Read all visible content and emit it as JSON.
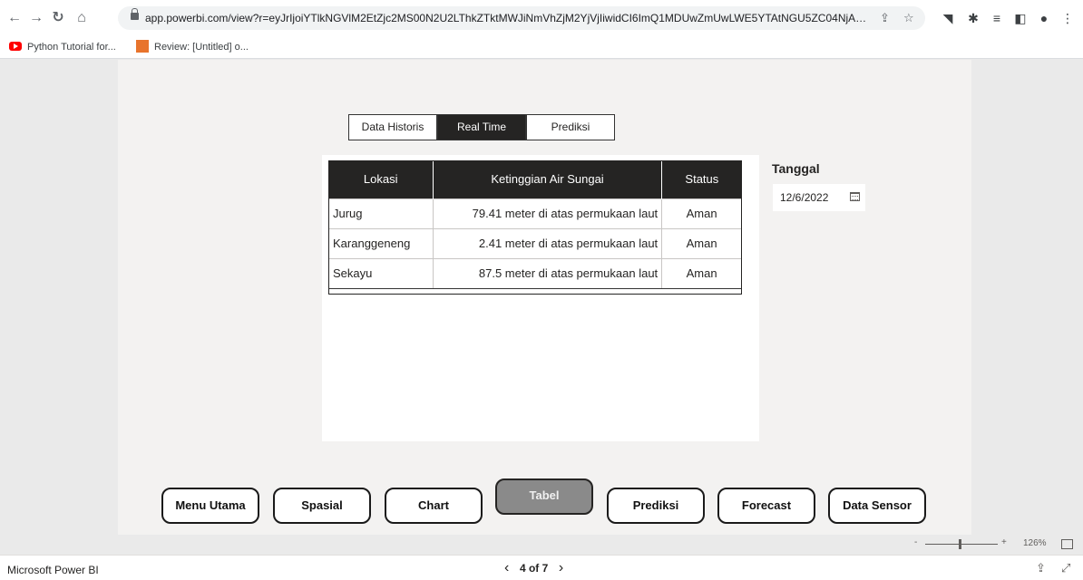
{
  "browser": {
    "url": "app.powerbi.com/view?r=eyJrIjoiYTlkNGVlM2EtZjc2MS00N2U2LThkZTktMWJiNmVhZjM2YjVjIiwidCI6ImQ1MDUwZmUwLWE5YTAtNGU5ZC04NjA4L...",
    "bookmarks": [
      "Python Tutorial for...",
      "Review: [Untitled] o..."
    ]
  },
  "report": {
    "tabs": [
      "Data Historis",
      "Real Time",
      "Prediksi"
    ],
    "active_tab": "Real Time",
    "table": {
      "headers": [
        "Lokasi",
        "Ketinggian Air Sungai",
        "Status"
      ],
      "rows": [
        [
          "Jurug",
          "79.41 meter di atas permukaan laut",
          "Aman"
        ],
        [
          "Karanggeneng",
          "2.41 meter di atas permukaan laut",
          "Aman"
        ],
        [
          "Sekayu",
          "87.5 meter di atas permukaan laut",
          "Aman"
        ]
      ]
    },
    "date_slicer": {
      "label": "Tanggal",
      "value": "12/6/2022"
    },
    "nav_buttons": [
      "Menu Utama",
      "Spasial",
      "Chart",
      "Tabel",
      "Prediksi",
      "Forecast",
      "Data Sensor"
    ],
    "current_nav": "Tabel"
  },
  "footer": {
    "app_name": "Microsoft Power BI",
    "page_indicator": "4 of 7",
    "zoom": "126%",
    "zoom_minus": "-",
    "zoom_plus": "+"
  },
  "colors": {
    "active_tab_bg": "#252423",
    "current_nav_bg": "#8a8a8a",
    "canvas_bg": "#f3f2f1"
  }
}
